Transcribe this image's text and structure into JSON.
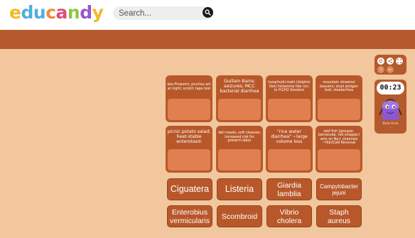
{
  "header": {
    "logo": {
      "letters": [
        "e",
        "d",
        "u",
        "c",
        "a",
        "n",
        "d",
        "y"
      ],
      "colors": [
        "#f2b928",
        "#4fb0d8",
        "#4fb0d8",
        "#f08a3a",
        "#e24b7a",
        "#8cc63f",
        "#9a56c8",
        "#f2b928"
      ]
    },
    "search": {
      "placeholder": "Search..."
    }
  },
  "colors": {
    "banner": "#b55a2c",
    "background": "#f2c79d",
    "card": "#b8582a",
    "drop_slot": "#e08050"
  },
  "cards": [
    {
      "text": "aka Pinworm; pruritus ani at night; scotch tape test"
    },
    {
      "text": "Guillain Barre; seizures; MCC bacterial diarrhea"
    },
    {
      "text": "tuna/mahi mahi (dolphin fish) histamine like rxn; tx H1/H2 blockers"
    },
    {
      "text": "mountain streams/ beavers; stool antigen test; steatorrhea"
    },
    {
      "text": "picnic potato salad; heat-stable enterotoxin"
    },
    {
      "text": "deli meats, soft cheeses; increased risk for preterm labor"
    },
    {
      "text": "\"rice water diarrhea\" ~large volume loss"
    },
    {
      "text": "reef fish (grouper, barracuda, red snapper) acts on Na+ channels ~Hot/Cold Reversal"
    }
  ],
  "answers": [
    {
      "label": "Ciguatera"
    },
    {
      "label": "Listeria"
    },
    {
      "label": "Giardia lamblia"
    },
    {
      "label": "Campylobacter jejuni"
    },
    {
      "label": "Enterobius vermicularis"
    },
    {
      "label": "Scombroid"
    },
    {
      "label": "Vibrio cholera"
    },
    {
      "label": "Staph aureus"
    }
  ],
  "controls": [
    {
      "icon": "restart-icon"
    },
    {
      "icon": "share-icon"
    },
    {
      "icon": "fullscreen-icon"
    },
    {
      "icon": "help-icon"
    },
    {
      "icon": "sound-icon"
    }
  ],
  "timer": {
    "value": "00:23",
    "best_label": "Best time",
    "best_value": "-"
  }
}
